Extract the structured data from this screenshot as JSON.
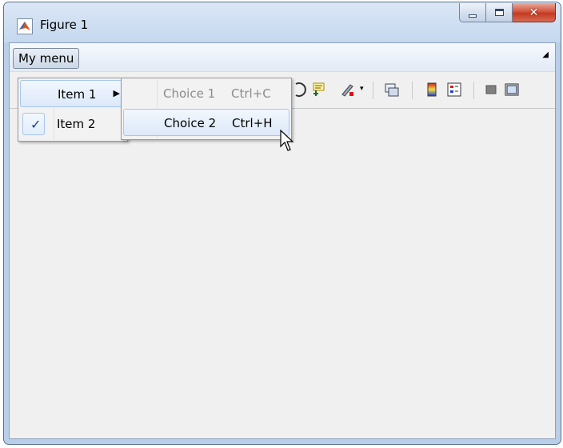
{
  "window": {
    "title": "Figure 1",
    "controls": {
      "minimize": "minimize-icon",
      "maximize": "maximize-icon",
      "close": "close-icon"
    }
  },
  "menubar": {
    "menu_label": "My menu"
  },
  "menu": {
    "items": [
      {
        "label": "Item 1",
        "has_submenu": true
      },
      {
        "label": "Item 2",
        "checked": true
      }
    ]
  },
  "submenu": {
    "items": [
      {
        "label": "Choice 1",
        "accelerator": "Ctrl+C",
        "enabled": false
      },
      {
        "label": "Choice 2",
        "accelerator": "Ctrl+H",
        "enabled": true,
        "highlighted": true
      }
    ]
  },
  "toolbar": {
    "icons": [
      "data-cursor-icon",
      "brush-icon",
      "link-icon",
      "colorbar-icon",
      "legend-icon",
      "hide-plot-tools-icon",
      "show-plot-tools-icon"
    ]
  }
}
